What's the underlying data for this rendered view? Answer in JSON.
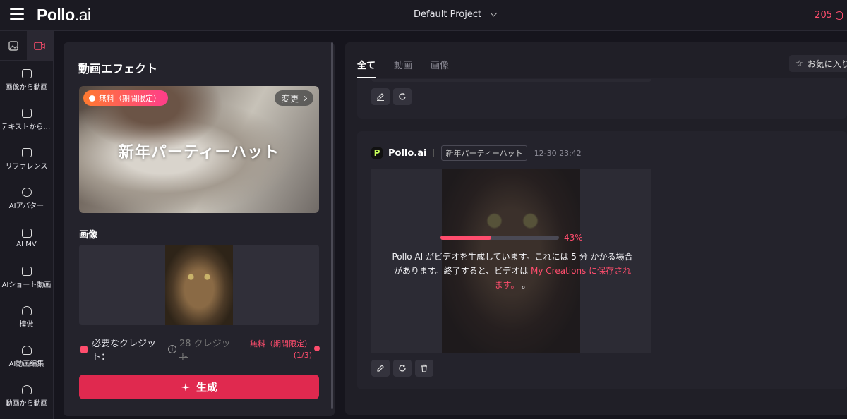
{
  "header": {
    "logo_main": "Pollo",
    "logo_suffix": ".ai",
    "project": "Default Project",
    "credits": "205"
  },
  "rail": {
    "items": [
      {
        "label": "画像から動画"
      },
      {
        "label": "テキストから動画"
      },
      {
        "label": "リファレンス"
      },
      {
        "label": "AIアバター"
      },
      {
        "label": "AI MV"
      },
      {
        "label": "AIショート動画"
      },
      {
        "label": "模倣"
      },
      {
        "label": "AI動画編集"
      },
      {
        "label": "動画から動画"
      }
    ]
  },
  "panel": {
    "title": "動画エフェクト",
    "badge": "無料（期間限定）",
    "change": "変更",
    "effect_name": "新年パーティーハット",
    "image_label": "画像",
    "credit_label": "必要なクレジット：",
    "credit_old": "28 クレジット",
    "credit_free": "無料（期間限定）(1/3)",
    "generate": "生成"
  },
  "main": {
    "tabs": [
      {
        "label": "全て"
      },
      {
        "label": "動画"
      },
      {
        "label": "画像"
      }
    ],
    "favorites": "お気に入り",
    "brand": "Pollo.ai",
    "effect_tag": "新年パーティーハット",
    "timestamp": "12-30 23:42",
    "progress": 0.43,
    "progress_text": "43%",
    "message_part1": "Pollo AI がビデオを生成しています。これには 5 分 かかる場合があります。終了すると、ビデオは ",
    "message_link": "My Creations に保存されます。",
    "message_part2": " 。"
  },
  "colors": {
    "accent": "#ff4d6d",
    "button": "#e0294f"
  }
}
